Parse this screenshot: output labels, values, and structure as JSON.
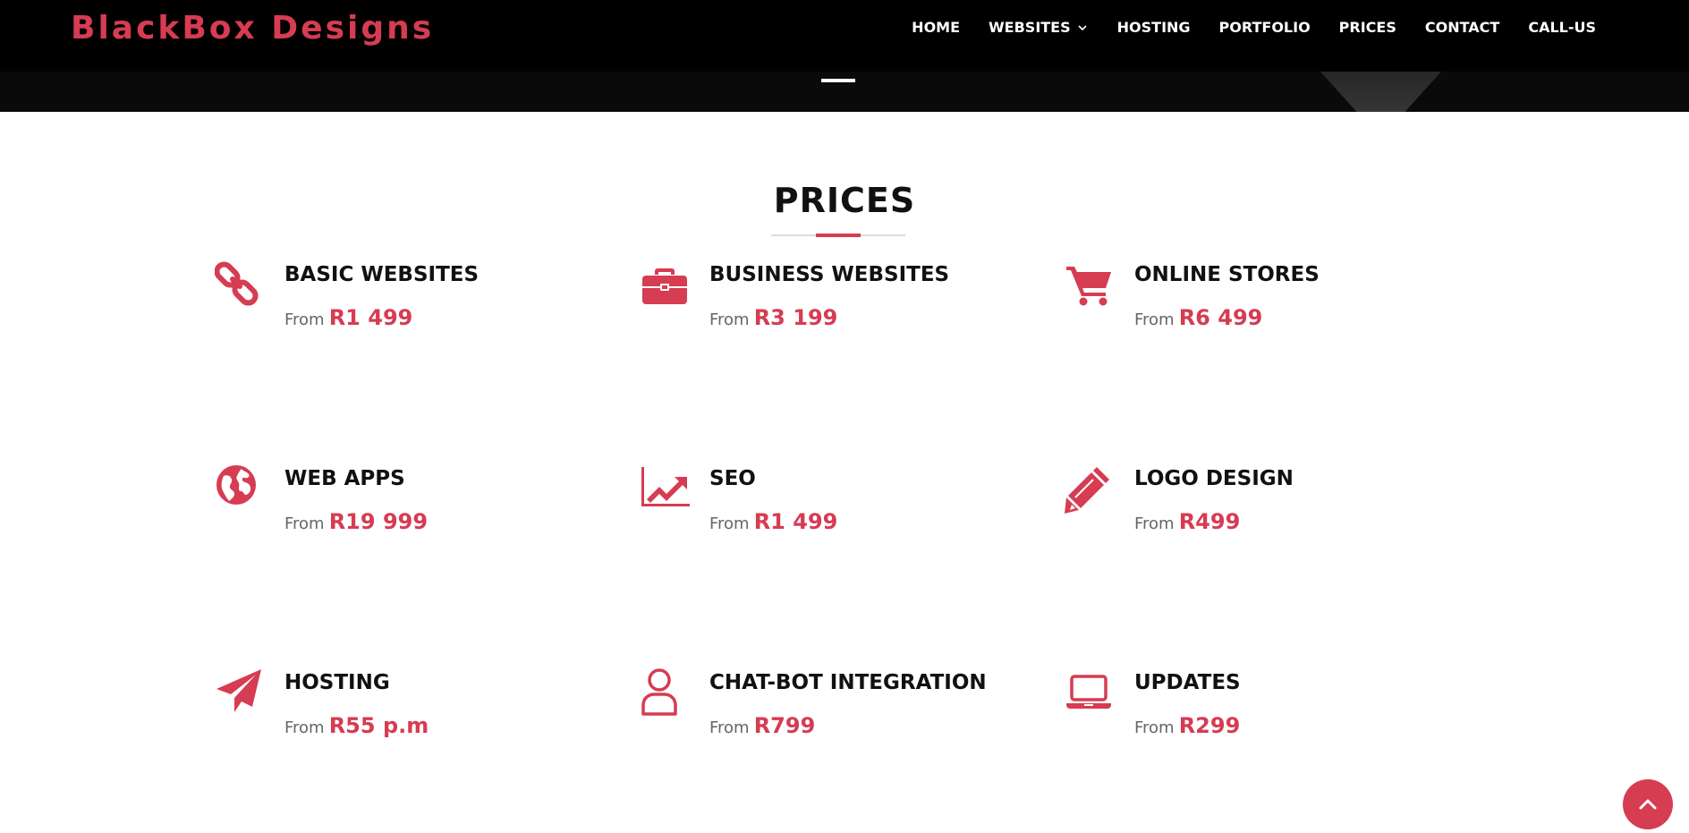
{
  "header": {
    "brand": "BlackBox Designs",
    "nav": [
      {
        "label": "HOME",
        "dropdown": false
      },
      {
        "label": "WEBSITES",
        "dropdown": true
      },
      {
        "label": "HOSTING",
        "dropdown": false
      },
      {
        "label": "PORTFOLIO",
        "dropdown": false
      },
      {
        "label": "PRICES",
        "dropdown": false
      },
      {
        "label": "CONTACT",
        "dropdown": false
      },
      {
        "label": "CALL-US",
        "dropdown": false
      }
    ]
  },
  "prices": {
    "title": "PRICES",
    "items": [
      {
        "name": "BASIC WEBSITES",
        "from": "From",
        "price": "R1 499",
        "icon": "link-icon"
      },
      {
        "name": "BUSINESS WEBSITES",
        "from": "From",
        "price": "R3 199",
        "icon": "briefcase-icon"
      },
      {
        "name": "ONLINE STORES",
        "from": "From",
        "price": "R6 499",
        "icon": "cart-icon"
      },
      {
        "name": "WEB APPS",
        "from": "From",
        "price": "R19 999",
        "icon": "globe-icon"
      },
      {
        "name": "SEO",
        "from": "From",
        "price": "R1 499",
        "icon": "chart-up-icon"
      },
      {
        "name": "LOGO DESIGN",
        "from": "From",
        "price": "R499",
        "icon": "pencil-icon"
      },
      {
        "name": "HOSTING",
        "from": "From",
        "price": "R55 p.m",
        "icon": "paper-plane-icon"
      },
      {
        "name": "CHAT-BOT INTEGRATION",
        "from": "From",
        "price": "R799",
        "icon": "user-icon"
      },
      {
        "name": "UPDATES",
        "from": "From",
        "price": "R299",
        "icon": "laptop-icon"
      }
    ]
  },
  "scroll_top_icon": "chevron-up-icon",
  "colors": {
    "accent": "#d63c52",
    "header_bg": "#000000",
    "text": "#111111"
  }
}
